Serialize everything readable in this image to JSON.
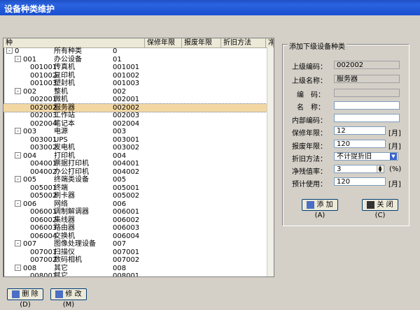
{
  "window": {
    "title": "设备种类维护"
  },
  "grid": {
    "columns": [
      "种",
      "保修年限",
      "报废年限",
      "折旧方法",
      "净"
    ],
    "rows": [
      {
        "expander": "-",
        "code": "0",
        "name": "所有种类",
        "col3": "0",
        "selected": false
      },
      {
        "expander": "-",
        "code": "001",
        "name": "办公设备",
        "col3": "01",
        "selected": false
      },
      {
        "expander": "",
        "code": "001001",
        "name": "传真机",
        "col3": "001001",
        "selected": false
      },
      {
        "expander": "",
        "code": "001002",
        "name": "复印机",
        "col3": "001002",
        "selected": false
      },
      {
        "expander": "",
        "code": "001003",
        "name": "塑封机",
        "col3": "001003",
        "selected": false
      },
      {
        "expander": "-",
        "code": "002",
        "name": "整机",
        "col3": "002",
        "selected": false
      },
      {
        "expander": "",
        "code": "002001",
        "name": "微机",
        "col3": "002001",
        "selected": false
      },
      {
        "expander": "",
        "code": "002002",
        "name": "服务器",
        "col3": "002002",
        "selected": true
      },
      {
        "expander": "",
        "code": "002003",
        "name": "工作站",
        "col3": "002003",
        "selected": false
      },
      {
        "expander": "",
        "code": "002004",
        "name": "笔记本",
        "col3": "002004",
        "selected": false
      },
      {
        "expander": "-",
        "code": "003",
        "name": "电源",
        "col3": "003",
        "selected": false
      },
      {
        "expander": "",
        "code": "003001",
        "name": "UPS",
        "col3": "003001",
        "selected": false
      },
      {
        "expander": "",
        "code": "003002",
        "name": "发电机",
        "col3": "003002",
        "selected": false
      },
      {
        "expander": "-",
        "code": "004",
        "name": "打印机",
        "col3": "004",
        "selected": false
      },
      {
        "expander": "",
        "code": "004001",
        "name": "票据打印机",
        "col3": "004001",
        "selected": false
      },
      {
        "expander": "",
        "code": "004002",
        "name": "办公打印机",
        "col3": "004002",
        "selected": false
      },
      {
        "expander": "-",
        "code": "005",
        "name": "终端类设备",
        "col3": "005",
        "selected": false
      },
      {
        "expander": "",
        "code": "005001",
        "name": "终端",
        "col3": "005001",
        "selected": false
      },
      {
        "expander": "",
        "code": "005002",
        "name": "刷卡器",
        "col3": "005002",
        "selected": false
      },
      {
        "expander": "-",
        "code": "006",
        "name": "网络",
        "col3": "006",
        "selected": false
      },
      {
        "expander": "",
        "code": "006001",
        "name": "调制解调器",
        "col3": "006001",
        "selected": false
      },
      {
        "expander": "",
        "code": "006002",
        "name": "集线器",
        "col3": "006002",
        "selected": false
      },
      {
        "expander": "",
        "code": "006003",
        "name": "路由器",
        "col3": "006003",
        "selected": false
      },
      {
        "expander": "",
        "code": "006004",
        "name": "交换机",
        "col3": "006004",
        "selected": false
      },
      {
        "expander": "-",
        "code": "007",
        "name": "图像处理设备",
        "col3": "007",
        "selected": false
      },
      {
        "expander": "",
        "code": "007001",
        "name": "扫描仪",
        "col3": "007001",
        "selected": false
      },
      {
        "expander": "",
        "code": "007002",
        "name": "数码相机",
        "col3": "007002",
        "selected": false
      },
      {
        "expander": "-",
        "code": "008",
        "name": "其它",
        "col3": "008",
        "selected": false
      },
      {
        "expander": "",
        "code": "008001",
        "name": "其它",
        "col3": "008001",
        "selected": false
      }
    ]
  },
  "form": {
    "legend": "添加下级设备种类",
    "parent_code_label": "上级编码：",
    "parent_code_value": "002002",
    "parent_name_label": "上级名称：",
    "parent_name_value": "服务器",
    "code_label": "编　码：",
    "code_value": "",
    "name_label": "名　称：",
    "name_value": "",
    "internal_code_label": "内部编码：",
    "internal_code_value": "",
    "warranty_label": "保修年限：",
    "warranty_value": "12",
    "warranty_unit": "[月]",
    "scrap_label": "报废年限：",
    "scrap_value": "120",
    "scrap_unit": "[月]",
    "depreciation_label": "折旧方法：",
    "depreciation_value": "不计提折旧",
    "residual_label": "净残值率：",
    "residual_value": "3",
    "residual_unit": "(%)",
    "expected_use_label": "预计使用：",
    "expected_use_value": "120",
    "expected_use_unit": "[月]",
    "add_button": "添 加(A)",
    "close_button": "关 闭(C)"
  },
  "bottom": {
    "delete_button": "删 除(D)",
    "modify_button": "修 改(M)"
  },
  "colors": {
    "titlebar": "#2a63e0",
    "selected_row": "#f3d7a2"
  }
}
